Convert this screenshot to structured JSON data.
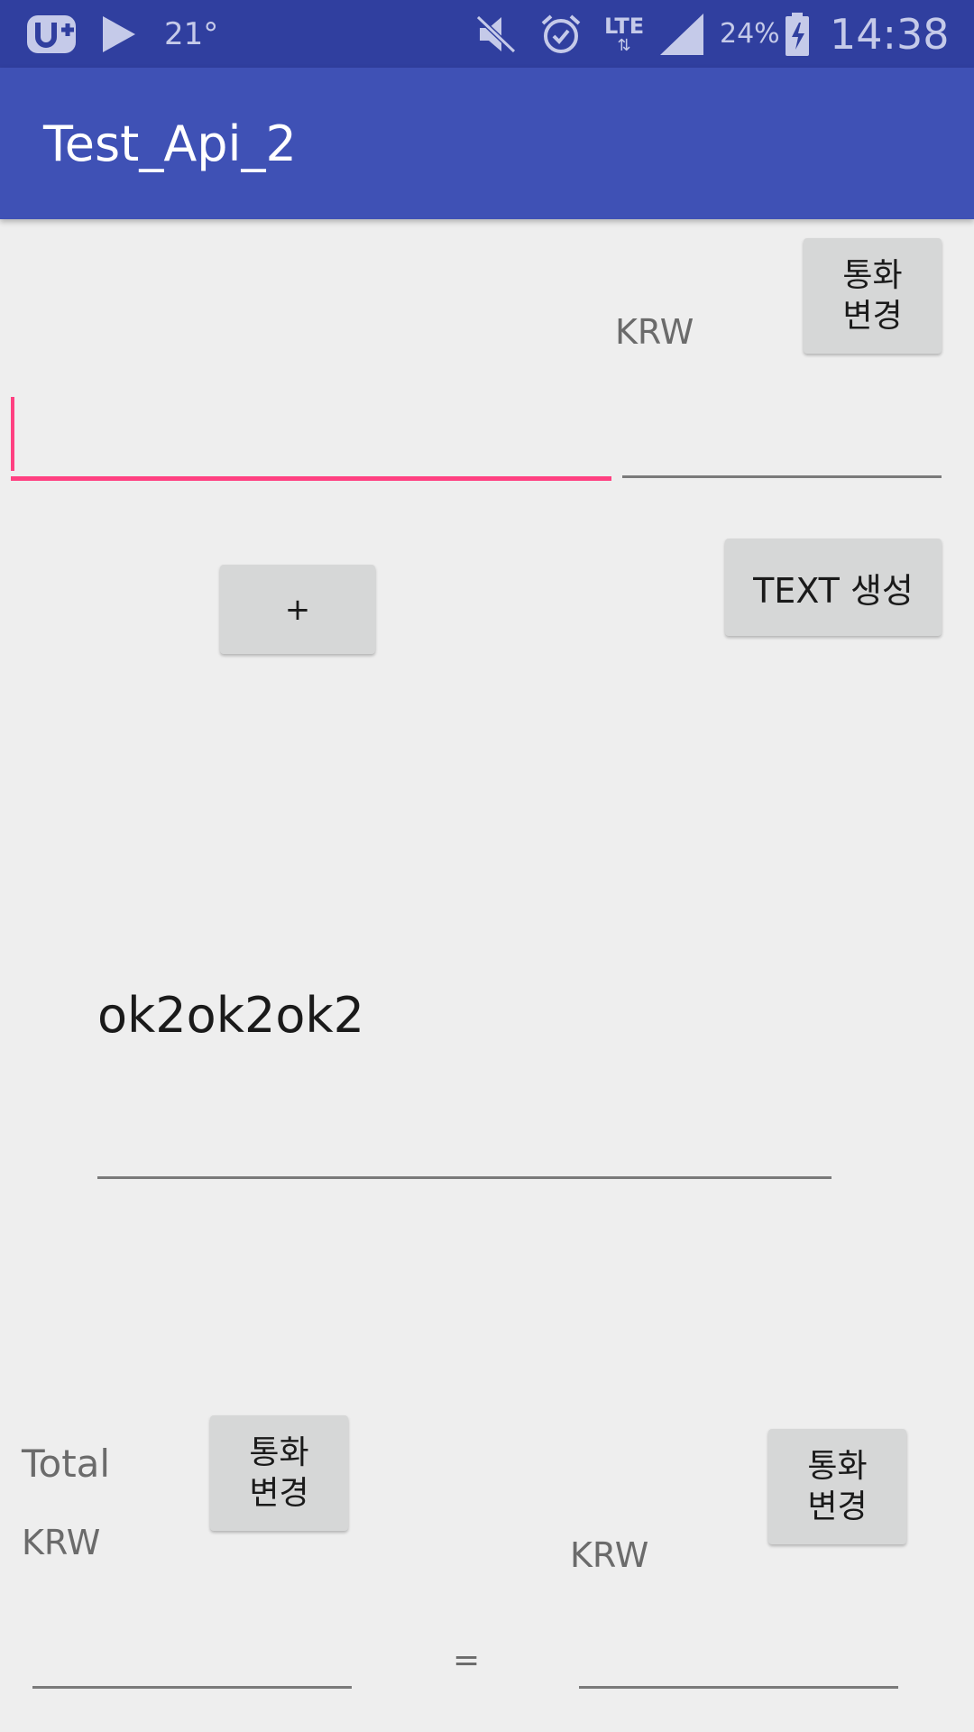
{
  "status_bar": {
    "temperature": "21°",
    "network": "LTE",
    "battery_percent": "24%",
    "time": "14:38",
    "icons": [
      "u-plus-logo-icon",
      "play-store-icon",
      "mute-icon",
      "alarm-icon",
      "lte-data-icon",
      "signal-icon",
      "battery-charging-icon"
    ]
  },
  "app_bar": {
    "title": "Test_Api_2"
  },
  "top_section": {
    "currency_button_label_line1": "통화",
    "currency_button_label_line2": "변경",
    "currency_label": "KRW",
    "amount_input_value": "",
    "converted_field_value": "",
    "plus_button_label": "+",
    "text_button_label": "TEXT 생성"
  },
  "middle_section": {
    "generated_text": "ok2ok2ok2"
  },
  "bottom_section": {
    "total_label": "Total",
    "left_currency_label": "KRW",
    "left_button_label_line1": "통화",
    "left_button_label_line2": "변경",
    "right_currency_label": "KRW",
    "right_button_label_line1": "통화",
    "right_button_label_line2": "변경",
    "equals_label": "="
  },
  "colors": {
    "status_bar": "#303f9f",
    "app_bar": "#3f51b5",
    "background": "#eeeeee",
    "accent": "#ff4081",
    "button": "#d6d7d7"
  }
}
